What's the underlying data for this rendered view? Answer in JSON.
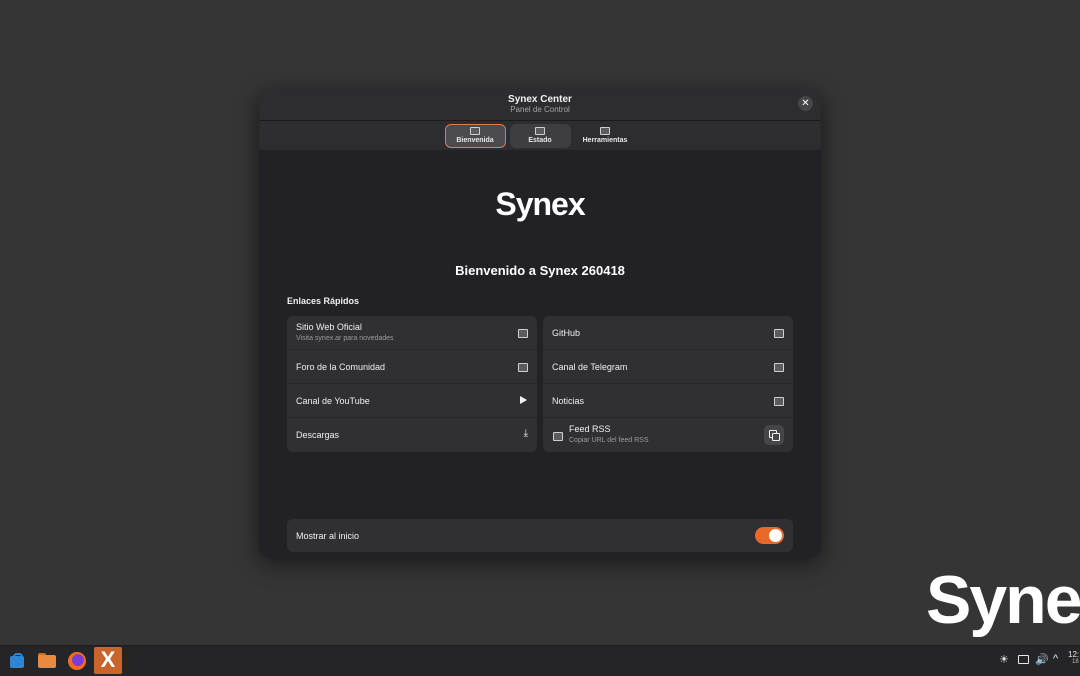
{
  "desktop": {
    "logo_text": "Synex"
  },
  "window": {
    "title": "Synex Center",
    "subtitle": "Panel de Control",
    "close_glyph": "✕",
    "tabs": [
      {
        "label": "Bienvenida",
        "icon": "tab-icon",
        "active": true
      },
      {
        "label": "Estado",
        "icon": "tab-icon",
        "active": false
      },
      {
        "label": "Herramientas",
        "icon": "tab-icon",
        "active": false
      }
    ]
  },
  "welcome": {
    "brand": "Synex",
    "heading": "Bienvenido a Synex 260418",
    "section_title": "Enlaces Rápidos",
    "left_links": [
      {
        "label": "Sitio Web Oficial",
        "sublabel": "Visita synex.ar para novedades",
        "icon": "external-link-icon"
      },
      {
        "label": "Foro de la Comunidad",
        "icon": "external-link-icon"
      },
      {
        "label": "Canal de YouTube",
        "icon": "play-icon"
      },
      {
        "label": "Descargas",
        "icon": "download-icon"
      }
    ],
    "right_links": [
      {
        "label": "GitHub",
        "icon": "external-link-icon"
      },
      {
        "label": "Canal de Telegram",
        "icon": "external-link-icon"
      },
      {
        "label": "Noticias",
        "icon": "external-link-icon"
      },
      {
        "label": "Feed RSS",
        "sublabel": "Copiar URL del feed RSS",
        "icon": "copy-icon"
      }
    ],
    "startup_toggle": {
      "label": "Mostrar al inicio",
      "enabled": true
    }
  },
  "taskbar": {
    "apps": [
      "store-icon",
      "files-icon",
      "firefox-icon",
      "synex-icon"
    ],
    "synex_glyph": "X",
    "tray": {
      "brightness_glyph": "☀",
      "volume_glyph": "🔊",
      "expand_glyph": "^",
      "time": "12:",
      "date": "18"
    }
  },
  "colors": {
    "accent": "#e8692a",
    "window_bg": "#222226",
    "card_bg": "#303034",
    "desktop_bg": "#353535"
  }
}
